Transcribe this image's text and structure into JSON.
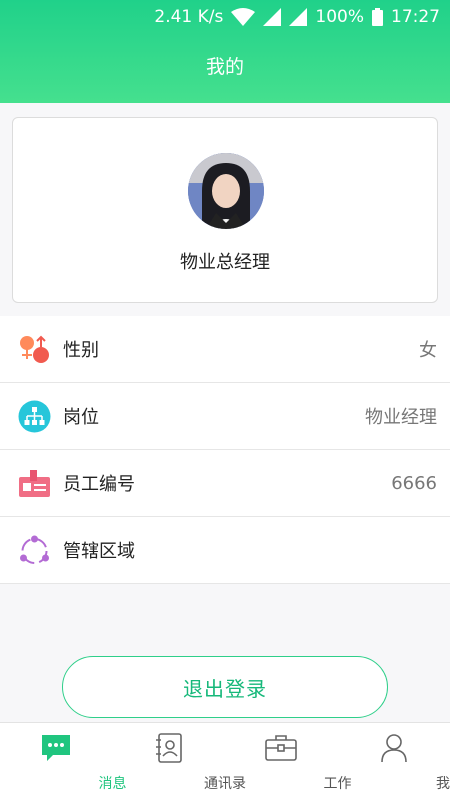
{
  "status_bar": {
    "speed": "2.41 K/s",
    "battery": "100%",
    "time": "17:27"
  },
  "header": {
    "title": "我的"
  },
  "profile": {
    "name": "物业总经理"
  },
  "info": [
    {
      "label": "性别",
      "value": "女",
      "icon": "gender-icon"
    },
    {
      "label": "岗位",
      "value": "物业经理",
      "icon": "org-chart-icon"
    },
    {
      "label": "员工编号",
      "value": "6666",
      "icon": "id-card-icon"
    },
    {
      "label": "管辖区域",
      "value": "",
      "icon": "area-icon"
    }
  ],
  "logout": {
    "label": "退出登录"
  },
  "nav": [
    {
      "label": "消息",
      "icon": "message-icon",
      "active": true
    },
    {
      "label": "通讯录",
      "icon": "contacts-icon",
      "active": false
    },
    {
      "label": "工作",
      "icon": "briefcase-icon",
      "active": false
    },
    {
      "label": "我的",
      "icon": "user-icon",
      "active": false
    }
  ],
  "colors": {
    "accent": "#20c57f",
    "header_top": "#20d18a",
    "header_bottom": "#45e08e"
  }
}
